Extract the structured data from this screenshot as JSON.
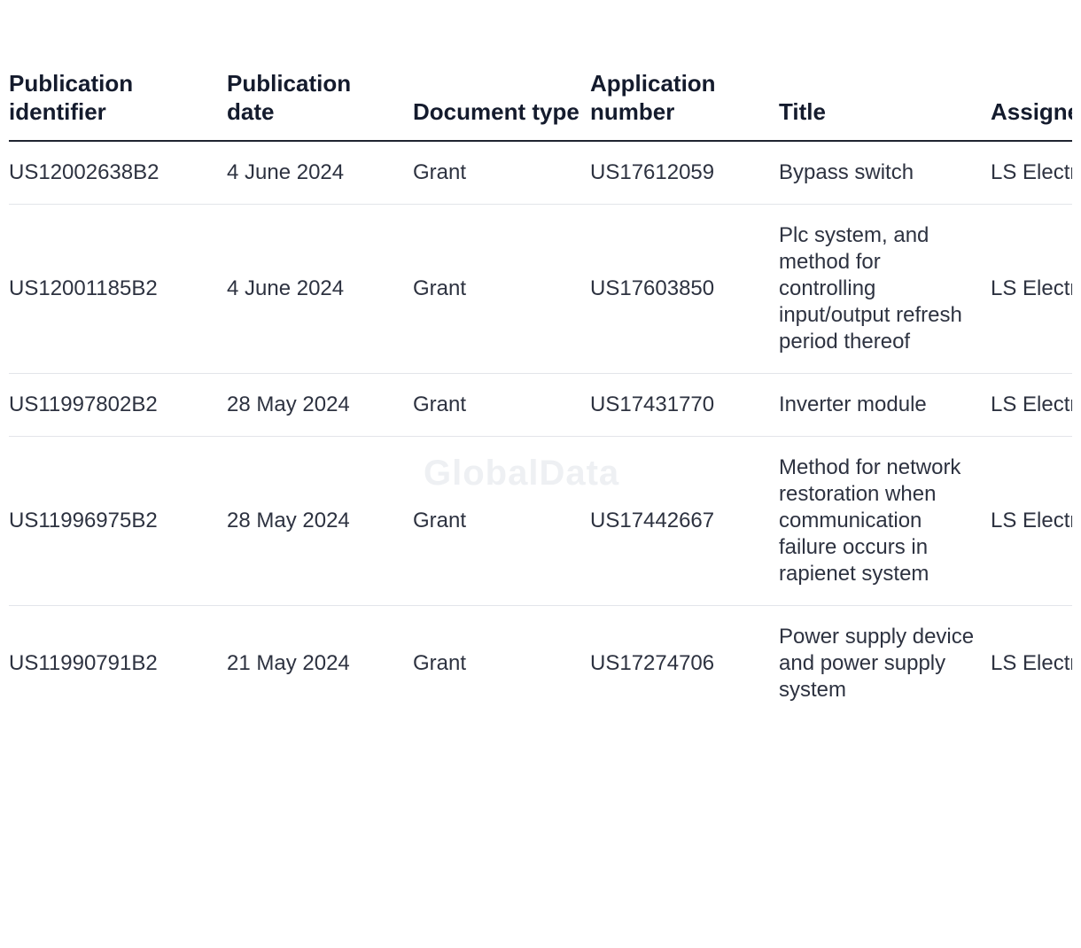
{
  "table": {
    "headers": [
      "Publication identifier",
      "Publication date",
      "Document type",
      "Application number",
      "Title",
      "Assignee"
    ],
    "rows": [
      {
        "publication_identifier": "US12002638B2",
        "publication_date": "4 June 2024",
        "document_type": "Grant",
        "application_number": "US17612059",
        "title": "Bypass switch",
        "assignee": "LS Electric Co Ltd"
      },
      {
        "publication_identifier": "US12001185B2",
        "publication_date": "4 June 2024",
        "document_type": "Grant",
        "application_number": "US17603850",
        "title": "Plc system, and method for controlling input/output refresh period thereof",
        "assignee": "LS Electric Co Ltd"
      },
      {
        "publication_identifier": "US11997802B2",
        "publication_date": "28 May 2024",
        "document_type": "Grant",
        "application_number": "US17431770",
        "title": "Inverter module",
        "assignee": "LS Electric Co Ltd"
      },
      {
        "publication_identifier": "US11996975B2",
        "publication_date": "28 May 2024",
        "document_type": "Grant",
        "application_number": "US17442667",
        "title": "Method for network restoration when communication failure occurs in rapienet system",
        "assignee": "LS Electric Co Ltd"
      },
      {
        "publication_identifier": "US11990791B2",
        "publication_date": "21 May 2024",
        "document_type": "Grant",
        "application_number": "US17274706",
        "title": "Power supply device and power supply system",
        "assignee": "LS Electric Co Ltd"
      }
    ]
  },
  "watermark": "GlobalData"
}
